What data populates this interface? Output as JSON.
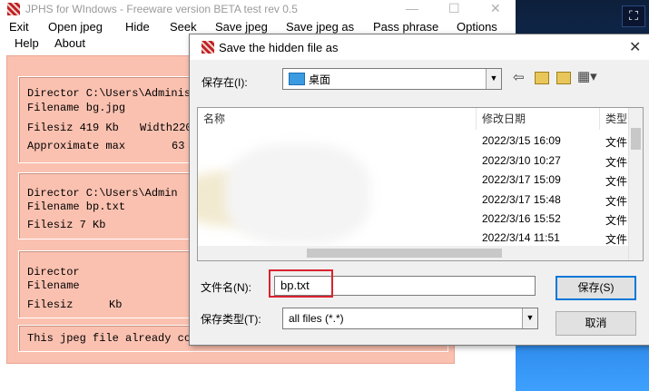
{
  "jphs": {
    "title": "JPHS for WIndows - Freeware version BETA test rev 0.5",
    "window_controls": [
      "—",
      "☐",
      "✕"
    ],
    "menu": [
      "Exit",
      "Open jpeg",
      "Hide",
      "Seek",
      "Save jpeg",
      "Save jpeg as",
      "Pass phrase",
      "Options",
      "Help",
      "About"
    ],
    "group1": {
      "directory": "Director C:\\Users\\Administ",
      "filename": "Filename bg.jpg",
      "filesize": "Filesiz 419 Kb",
      "width": "Width2200",
      "approx": "Approximate max",
      "approx_val": "63 K"
    },
    "group2": {
      "directory": "Director C:\\Users\\Admin",
      "filename": "Filename bp.txt",
      "filesize": "Filesiz    7 Kb"
    },
    "group3": {
      "directory": "Director",
      "filename": "Filename",
      "filesize": "Filesiz",
      "filesize_unit": "Kb"
    },
    "status": "This jpeg file already cont"
  },
  "dialog": {
    "title": "Save the hidden file as",
    "close": "✕",
    "location_label": "保存在(I):",
    "location_value": "桌面",
    "toolbar_back": "⇦",
    "toolbar_view": "▦▾",
    "columns": {
      "name": "名称",
      "date": "修改日期",
      "type": "类型"
    },
    "rows": [
      {
        "date": "2022/3/15 16:09",
        "type": "文件"
      },
      {
        "date": "2022/3/10 10:27",
        "type": "文件"
      },
      {
        "date": "2022/3/17 15:09",
        "type": "文件"
      },
      {
        "date": "2022/3/17 15:48",
        "type": "文件"
      },
      {
        "date": "2022/3/16 15:52",
        "type": "文件"
      },
      {
        "date": "2022/3/14 11:51",
        "type": "文件"
      }
    ],
    "filename_label": "文件名(N):",
    "filename_value": "bp.txt",
    "filetype_label": "保存类型(T):",
    "filetype_value": "all files (*.*)",
    "save_button": "保存(S)",
    "cancel_button": "取消"
  },
  "colors": {
    "panel": "#fbc1b0",
    "highlight": "#d9232f",
    "accent": "#0078d7"
  }
}
